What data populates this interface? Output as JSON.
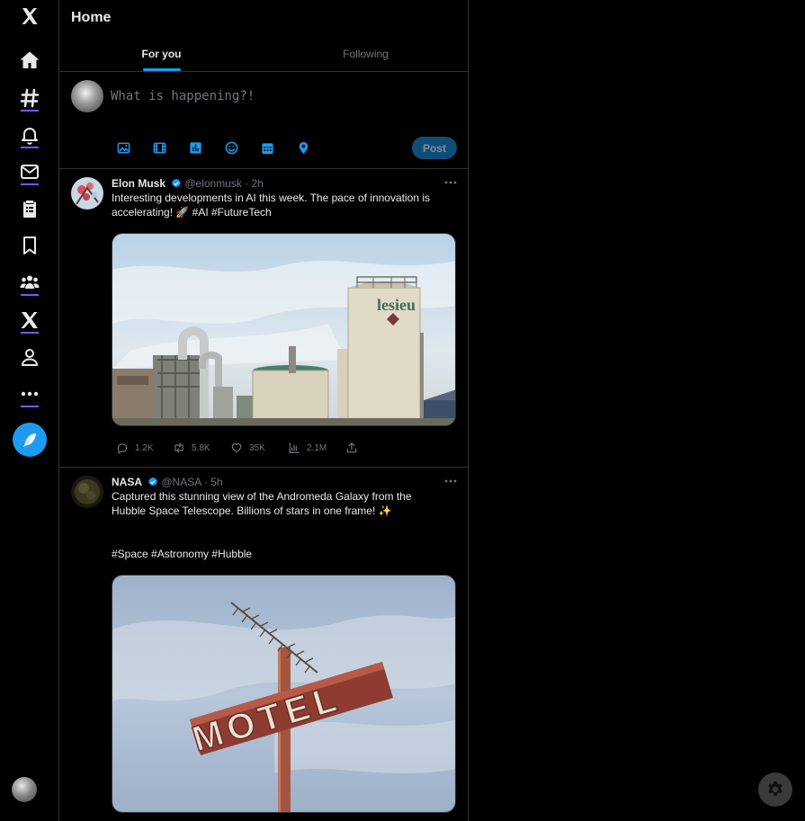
{
  "sidebar": {
    "items": [
      {
        "icon": "x-logo-icon"
      },
      {
        "icon": "home-icon"
      },
      {
        "icon": "hashtag-icon"
      },
      {
        "icon": "bell-icon"
      },
      {
        "icon": "mail-icon"
      },
      {
        "icon": "clipboard-list-icon"
      },
      {
        "icon": "bookmark-icon"
      },
      {
        "icon": "people-icon"
      },
      {
        "icon": "x-icon"
      },
      {
        "icon": "profile-icon"
      },
      {
        "icon": "more-icon"
      }
    ],
    "compose_icon": "feather-icon"
  },
  "header": {
    "title": "Home"
  },
  "tabs": [
    {
      "label": "For you",
      "active": true
    },
    {
      "label": "Following",
      "active": false
    }
  ],
  "composer": {
    "placeholder": "What is happening?!",
    "tools": [
      "image-icon",
      "gif-icon",
      "poll-icon",
      "emoji-icon",
      "schedule-icon",
      "location-icon"
    ],
    "post_label": "Post"
  },
  "tweets": [
    {
      "name": "Elon Musk",
      "handle": "@elonmusk",
      "dot": "·",
      "time": "2h",
      "text": "Interesting developments in AI this week. The pace of innovation is accelerating! 🚀 #AI #FutureTech",
      "replies": "1.2K",
      "retweets": "5.8K",
      "likes": "35K",
      "views": "2.1M"
    },
    {
      "name": "NASA",
      "handle": "@NASA",
      "dot": "·",
      "time": "5h",
      "text": "Captured this stunning view of the Andromeda Galaxy from the Hubble Space Telescope. Billions of stars in one frame! ✨",
      "hashtags": "#Space #Astronomy #Hubble",
      "sign_text": "MOTEL"
    }
  ],
  "media_0": {
    "sign_text": "lesieu"
  },
  "colors": {
    "accent": "#1d9bf0",
    "background": "#000000",
    "border": "#2f3336",
    "muted": "#71767b",
    "text": "#e7e9ea"
  }
}
